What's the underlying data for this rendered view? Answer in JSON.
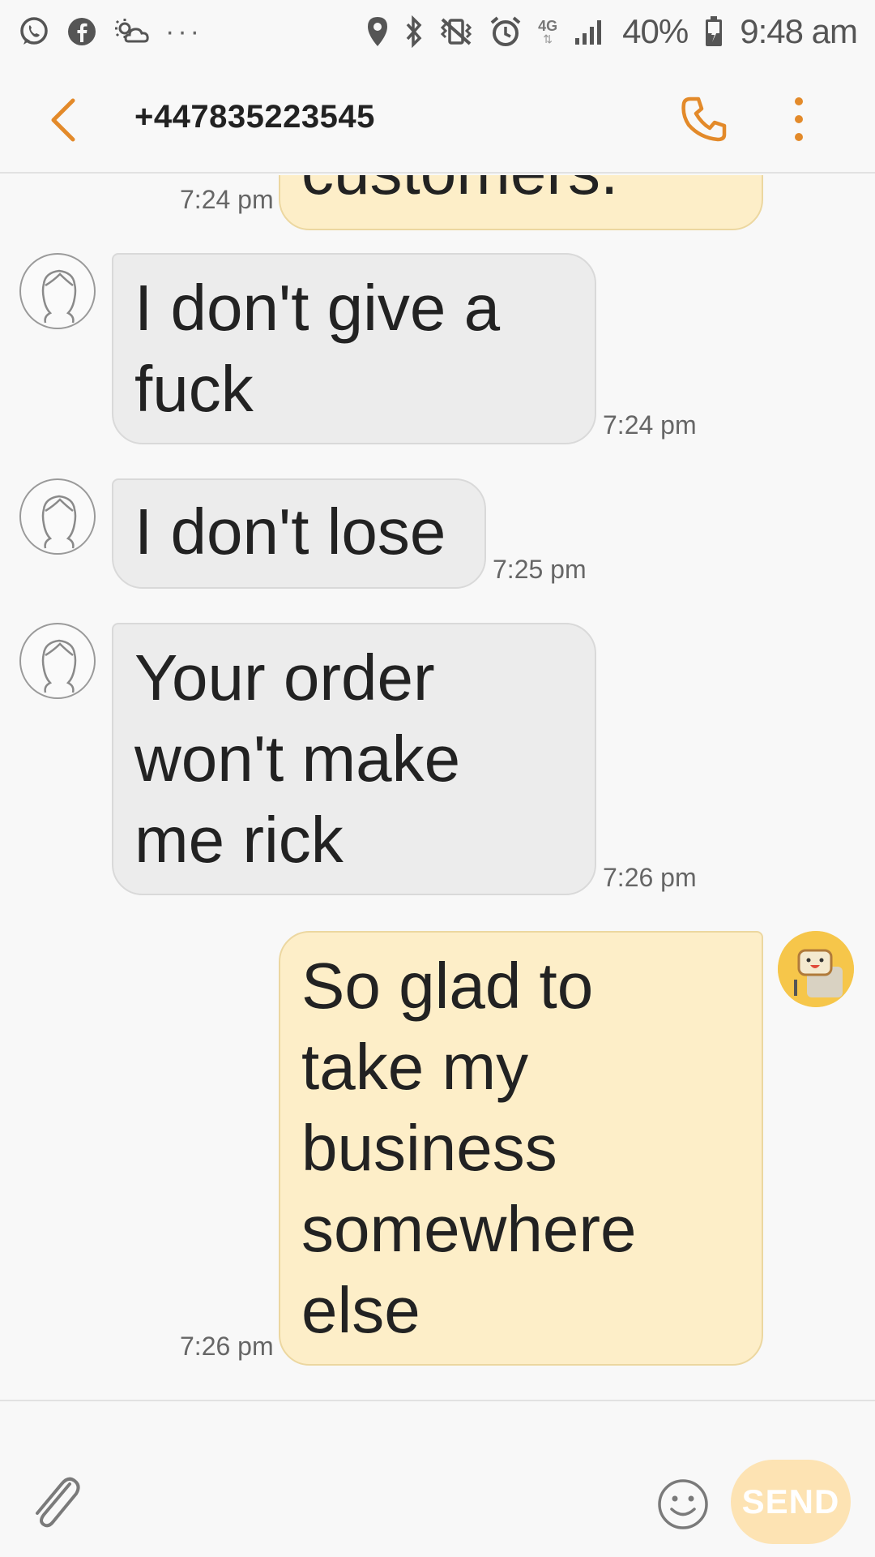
{
  "status_bar": {
    "battery_percent": "40%",
    "time": "9:48 am",
    "network": "4G",
    "overflow": "···",
    "icons": [
      "whatsapp-icon",
      "facebook-icon",
      "weather-icon",
      "location-icon",
      "bluetooth-icon",
      "vibrate-icon",
      "alarm-icon",
      "signal-icon",
      "battery-icon"
    ]
  },
  "app_bar": {
    "title": "+447835223545",
    "accent": "#e38a2a"
  },
  "conversation": {
    "partial_message": {
      "text": "customers.",
      "time": "7:24 pm"
    },
    "messages": [
      {
        "direction": "in",
        "text": "I don't give a fuck",
        "line1": "I don't give a",
        "line2": "fuck",
        "time": "7:24 pm"
      },
      {
        "direction": "in",
        "text": "I don't lose",
        "line1": "I don't lose",
        "time": "7:25 pm"
      },
      {
        "direction": "in",
        "text": "Your order won't make me rick",
        "line1": "Your order",
        "line2": "won't make",
        "line3": "me rick",
        "time": "7:26 pm"
      },
      {
        "direction": "out",
        "text": "So glad to take my business somewhere else",
        "line1": "So glad to",
        "line2": "take my",
        "line3": "business",
        "line4": "somewhere",
        "line5": "else",
        "time": "7:26 pm"
      }
    ]
  },
  "composer": {
    "send_label": "SEND",
    "send_color": "#fde3b3"
  }
}
